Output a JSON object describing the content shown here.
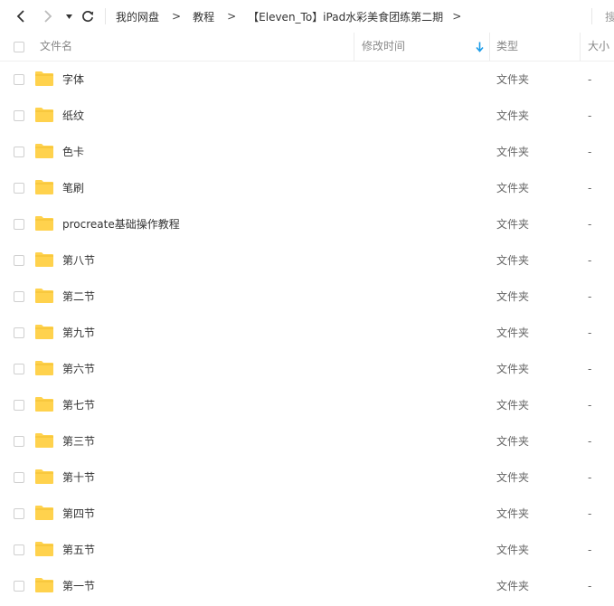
{
  "nav": {
    "breadcrumb": [
      {
        "label": "我的网盘"
      },
      {
        "label": "教程"
      },
      {
        "label": "【Eleven_To】iPad水彩美食团练第二期"
      }
    ],
    "separator": ">",
    "search_hint": "搜"
  },
  "columns": {
    "name": "文件名",
    "modified": "修改时间",
    "type": "类型",
    "size": "大小"
  },
  "sort_indicator_color": "#1a9be8",
  "folder_color": "#ffd24d",
  "files": [
    {
      "name": "字体",
      "modified": "",
      "type": "文件夹",
      "size": "-"
    },
    {
      "name": "纸纹",
      "modified": "",
      "type": "文件夹",
      "size": "-"
    },
    {
      "name": "色卡",
      "modified": "",
      "type": "文件夹",
      "size": "-"
    },
    {
      "name": "笔刷",
      "modified": "",
      "type": "文件夹",
      "size": "-"
    },
    {
      "name": "procreate基础操作教程",
      "modified": "",
      "type": "文件夹",
      "size": "-"
    },
    {
      "name": "第八节",
      "modified": "",
      "type": "文件夹",
      "size": "-"
    },
    {
      "name": "第二节",
      "modified": "",
      "type": "文件夹",
      "size": "-"
    },
    {
      "name": "第九节",
      "modified": "",
      "type": "文件夹",
      "size": "-"
    },
    {
      "name": "第六节",
      "modified": "",
      "type": "文件夹",
      "size": "-"
    },
    {
      "name": "第七节",
      "modified": "",
      "type": "文件夹",
      "size": "-"
    },
    {
      "name": "第三节",
      "modified": "",
      "type": "文件夹",
      "size": "-"
    },
    {
      "name": "第十节",
      "modified": "",
      "type": "文件夹",
      "size": "-"
    },
    {
      "name": "第四节",
      "modified": "",
      "type": "文件夹",
      "size": "-"
    },
    {
      "name": "第五节",
      "modified": "",
      "type": "文件夹",
      "size": "-"
    },
    {
      "name": "第一节",
      "modified": "",
      "type": "文件夹",
      "size": "-"
    }
  ]
}
